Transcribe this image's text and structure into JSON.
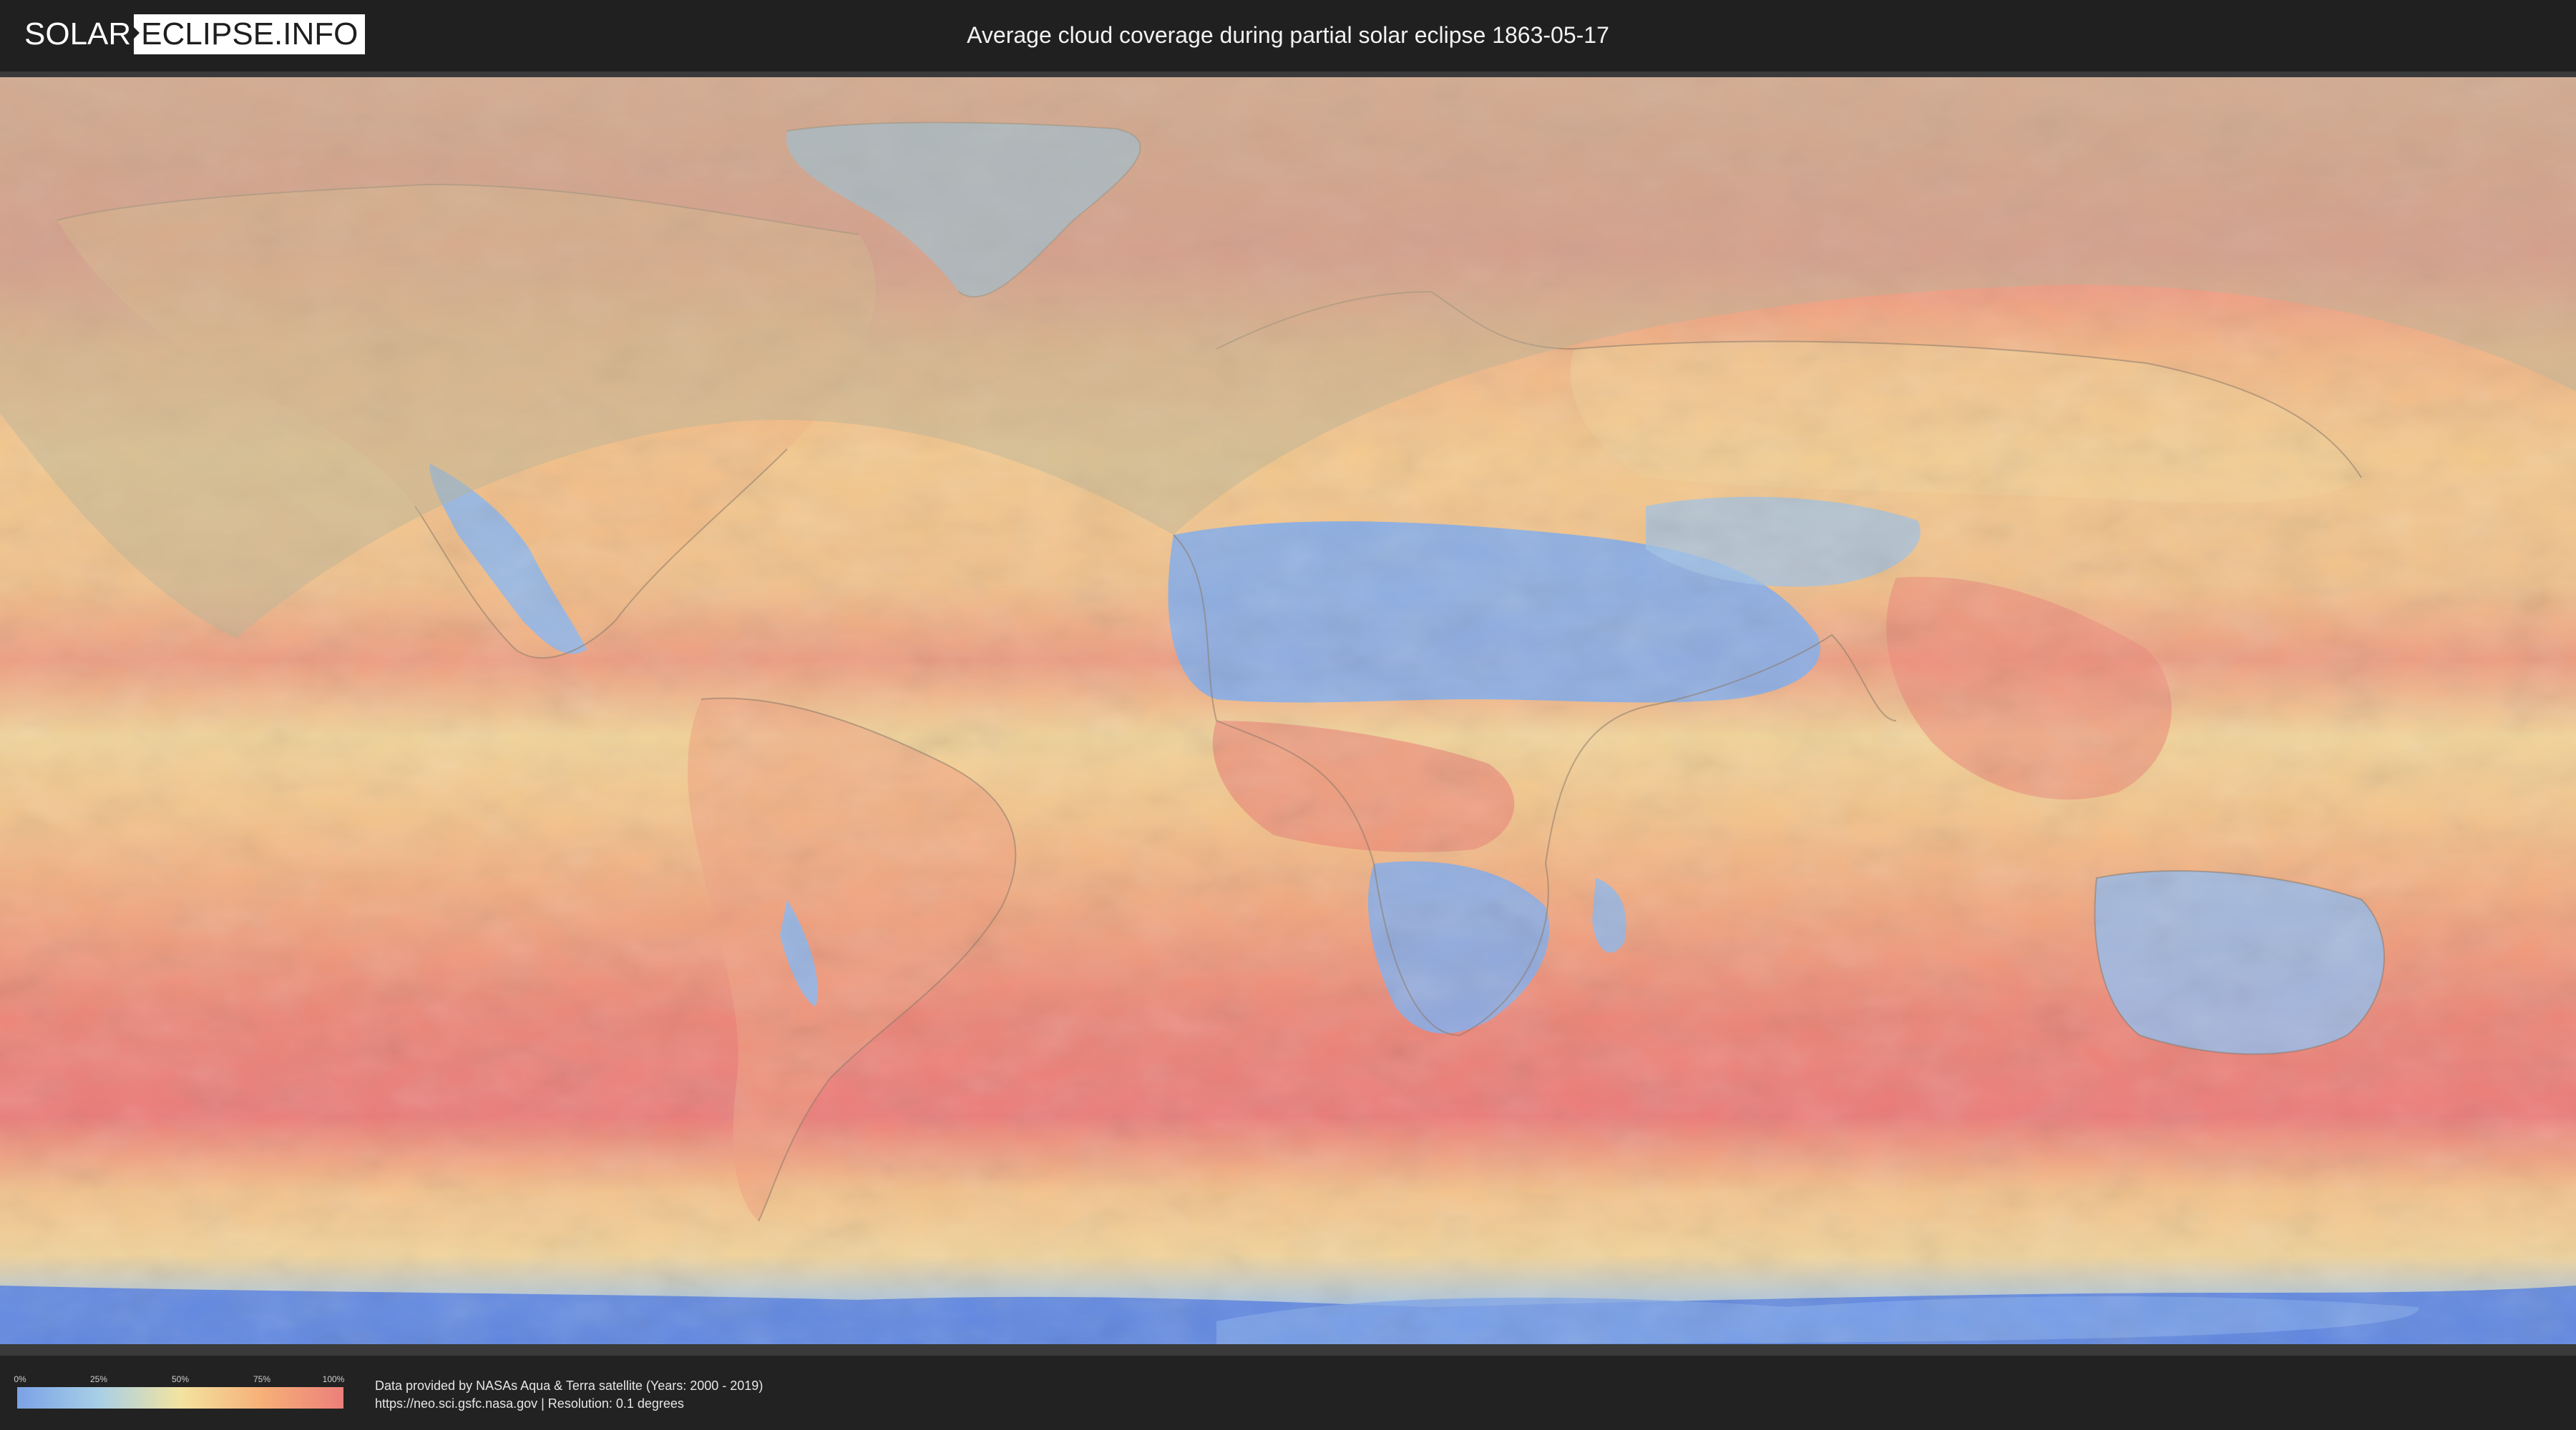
{
  "header": {
    "logo_part1": "SOLAR",
    "logo_part2": "ECLIPSE.INFO",
    "title": "Average cloud coverage during partial solar eclipse 1863-05-17"
  },
  "legend": {
    "ticks": [
      "0%",
      "25%",
      "50%",
      "75%",
      "100%"
    ],
    "colors": [
      "#7aa2e6",
      "#a8cfe6",
      "#f3e3a0",
      "#f6b078",
      "#ec7f7a"
    ]
  },
  "footer": {
    "credit_line1": "Data provided by NASAs Aqua & Terra satellite (Years: 2000 - 2019)",
    "credit_line2": "https://neo.sci.gsfc.nasa.gov | Resolution: 0.1 degrees"
  },
  "map": {
    "type": "cloud-coverage world map",
    "colors": {
      "clear": "#7aa2e6",
      "low": "#a8cfe6",
      "medium": "#f3e3a0",
      "high": "#f6b078",
      "overcast": "#ec7f7a",
      "eclipse_shade": "#b9b39a"
    }
  }
}
